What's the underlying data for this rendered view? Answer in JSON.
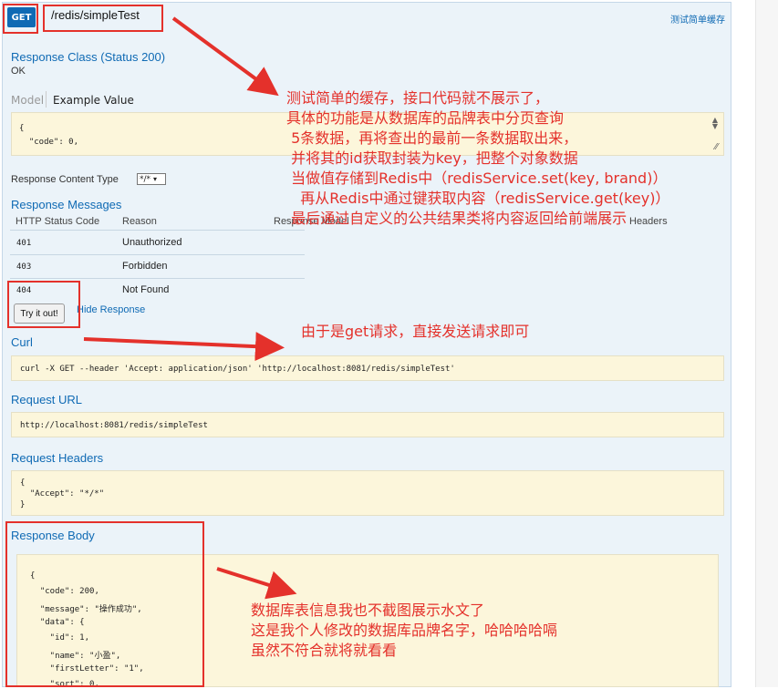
{
  "endpoint": {
    "method": "GET",
    "path": "/redis/simpleTest",
    "summary": "测试简单缓存"
  },
  "response_class": {
    "title": "Response Class (Status 200)",
    "status_text": "OK",
    "tab_model": "Model",
    "tab_example": "Example Value",
    "example_lines": [
      "{",
      "  \"code\": 0,"
    ]
  },
  "content_type": {
    "label": "Response Content Type",
    "value": "*/*"
  },
  "response_messages": {
    "title": "Response Messages",
    "headers": [
      "HTTP Status Code",
      "Reason",
      "Response Model",
      "Headers"
    ],
    "rows": [
      {
        "code": "401",
        "reason": "Unauthorized"
      },
      {
        "code": "403",
        "reason": "Forbidden"
      },
      {
        "code": "404",
        "reason": "Not Found"
      }
    ]
  },
  "actions": {
    "try_label": "Try it out!",
    "hide_label": "Hide Response"
  },
  "curl": {
    "title": "Curl",
    "command": "curl -X GET --header 'Accept: application/json' 'http://localhost:8081/redis/simpleTest'"
  },
  "request_url": {
    "title": "Request URL",
    "value": "http://localhost:8081/redis/simpleTest"
  },
  "request_headers": {
    "title": "Request Headers",
    "lines": [
      "{",
      "  \"Accept\": \"*/*\"",
      "}"
    ]
  },
  "response_body": {
    "title": "Response Body",
    "lines": [
      "{",
      "  \"code\": 200,",
      "  \"message\": \"操作成功\",",
      "  \"data\": {",
      "    \"id\": 1,",
      "    \"name\": \"小盈\",",
      "    \"firstLetter\": \"1\",",
      "    \"sort\": 0,"
    ]
  },
  "annotations": {
    "note1": [
      "测试简单的缓存，接口代码就不展示了，",
      "具体的功能是从数据库的品牌表中分页查询",
      " 5条数据，再将查出的最前一条数据取出来，",
      " 并将其的id获取封装为key，把整个对象数据",
      " 当做值存储到Redis中（redisService.set(key, brand)）",
      "   再从Redis中通过键获取内容（redisService.get(key)）",
      " 最后通过自定义的公共结果类将内容返回给前端展示"
    ],
    "note2": "由于是get请求，直接发送请求即可",
    "note3": [
      "数据库表信息我也不截图展示水文了",
      "这是我个人修改的数据库品牌名字，哈哈哈哈嗝",
      "虽然不符合就将就看看"
    ]
  },
  "colors": {
    "accent": "#0f6ab4",
    "annotation_red": "#e4312b",
    "code_bg": "#fcf6db",
    "panel_bg": "#ebf3f9"
  }
}
